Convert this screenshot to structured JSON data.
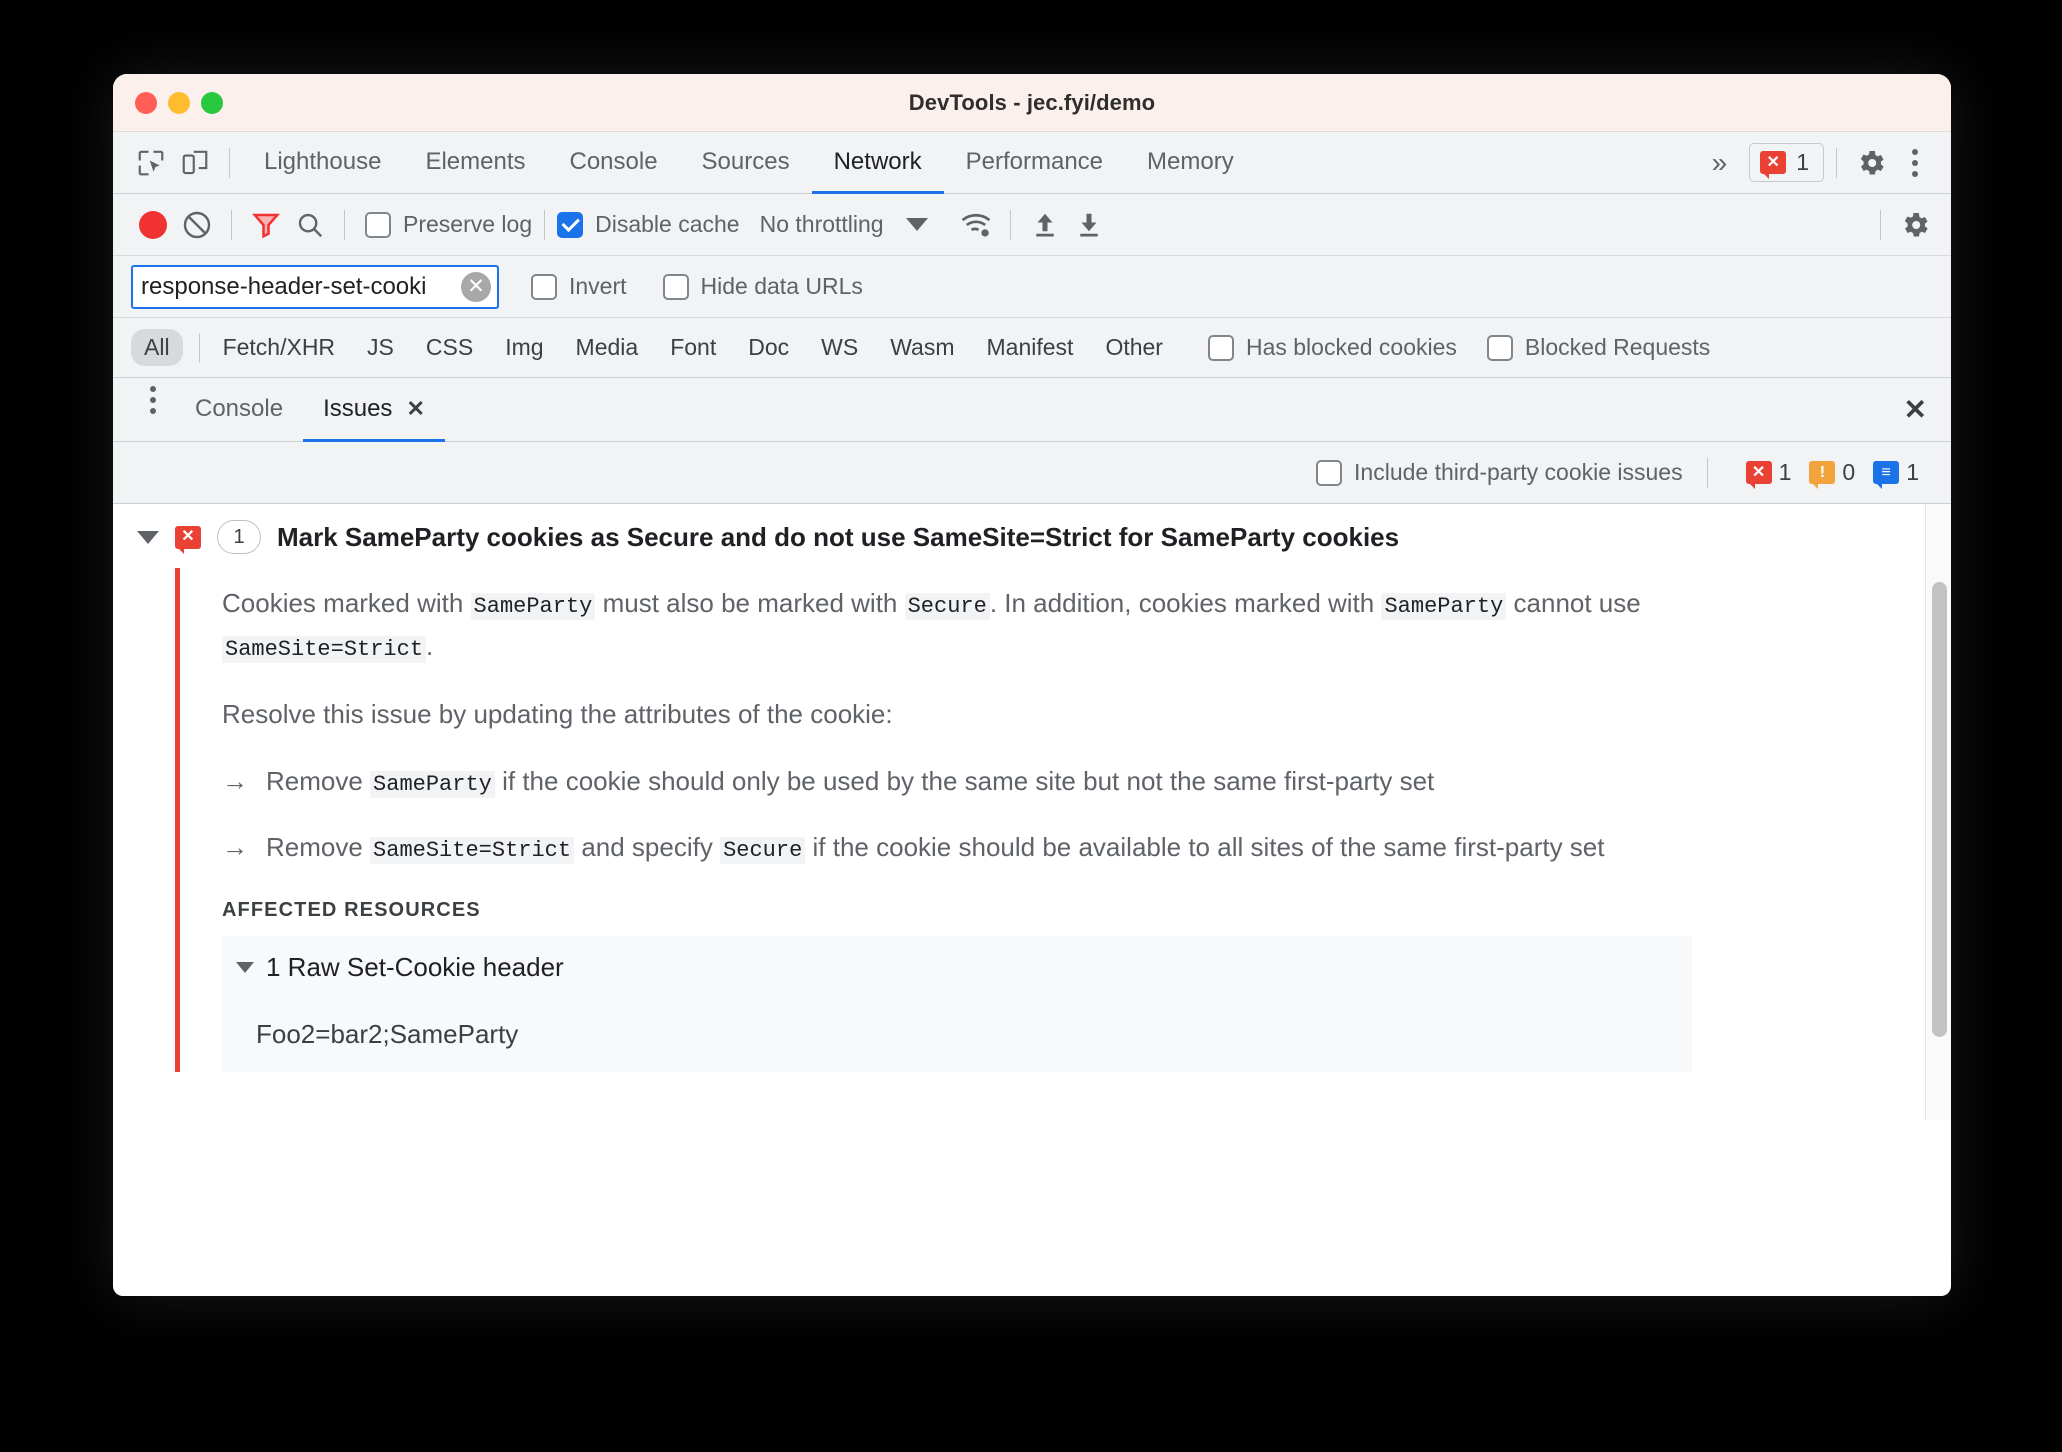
{
  "window": {
    "title": "DevTools - jec.fyi/demo",
    "traffic_lights": [
      "close-red",
      "minimize-yellow",
      "zoom-green"
    ]
  },
  "tabbar": {
    "left_icons": [
      "inspect-element-icon",
      "device-toolbar-icon"
    ],
    "tabs": [
      {
        "label": "Lighthouse",
        "active": false
      },
      {
        "label": "Elements",
        "active": false
      },
      {
        "label": "Console",
        "active": false
      },
      {
        "label": "Sources",
        "active": false
      },
      {
        "label": "Network",
        "active": true
      },
      {
        "label": "Performance",
        "active": false
      },
      {
        "label": "Memory",
        "active": false
      }
    ],
    "more_tabs": "»",
    "error_badge": {
      "icon": "error-bubble-icon",
      "glyph": "✕",
      "count": "1"
    },
    "settings_icon": "gear-icon",
    "menu_icon": "kebab-menu-icon"
  },
  "network_toolbar": {
    "record_button": "record-icon",
    "clear_button": "clear-icon",
    "filter_button": "filter-funnel-icon",
    "search_button": "search-icon",
    "preserve_log": {
      "label": "Preserve log",
      "checked": false
    },
    "disable_cache": {
      "label": "Disable cache",
      "checked": true
    },
    "throttling": "No throttling",
    "network_conditions_icon": "wifi-settings-icon",
    "import_har_icon": "import-arrow-icon",
    "export_har_icon": "export-arrow-icon",
    "settings_icon": "gear-icon"
  },
  "filter_row": {
    "input_value": "response-header-set-cooki",
    "input_placeholder": "Filter",
    "clear_glyph": "✕",
    "invert": {
      "label": "Invert",
      "checked": false
    },
    "hide_data_urls": {
      "label": "Hide data URLs",
      "checked": false
    }
  },
  "type_filters": {
    "items": [
      {
        "label": "All",
        "selected": true
      },
      {
        "label": "Fetch/XHR",
        "selected": false
      },
      {
        "label": "JS",
        "selected": false
      },
      {
        "label": "CSS",
        "selected": false
      },
      {
        "label": "Img",
        "selected": false
      },
      {
        "label": "Media",
        "selected": false
      },
      {
        "label": "Font",
        "selected": false
      },
      {
        "label": "Doc",
        "selected": false
      },
      {
        "label": "WS",
        "selected": false
      },
      {
        "label": "Wasm",
        "selected": false
      },
      {
        "label": "Manifest",
        "selected": false
      },
      {
        "label": "Other",
        "selected": false
      }
    ],
    "has_blocked_cookies": {
      "label": "Has blocked cookies",
      "checked": false
    },
    "blocked_requests": {
      "label": "Blocked Requests",
      "checked": false
    }
  },
  "drawer": {
    "menu_icon": "kebab-menu-icon",
    "tabs": [
      {
        "label": "Console",
        "active": false,
        "closable": false
      },
      {
        "label": "Issues",
        "active": true,
        "closable": true
      }
    ],
    "close_glyph": "✕",
    "close_drawer_glyph": "✕"
  },
  "issues_toolbar": {
    "include_third_party": {
      "label": "Include third-party cookie issues",
      "checked": false
    },
    "counters": [
      {
        "kind": "error",
        "glyph": "✕",
        "count": "1"
      },
      {
        "kind": "warning",
        "glyph": "!",
        "count": "0"
      },
      {
        "kind": "info",
        "glyph": "≡",
        "count": "1"
      }
    ]
  },
  "issue": {
    "expanded": true,
    "badge_glyph": "✕",
    "count": "1",
    "title": "Mark SameParty cookies as Secure and do not use SameSite=Strict for SameParty cookies",
    "paragraph1": {
      "p1": "Cookies marked with ",
      "c1": "SameParty",
      "p2": " must also be marked with ",
      "c2": "Secure",
      "p3": ". In addition, cookies marked with ",
      "c3": "SameParty",
      "p4": " cannot use ",
      "c4": "SameSite=Strict",
      "p5": "."
    },
    "paragraph2": "Resolve this issue by updating the attributes of the cookie:",
    "arrow_marker": "→",
    "list": [
      {
        "p1": "Remove ",
        "c1": "SameParty",
        "p2": " if the cookie should only be used by the same site but not the same first-party set",
        "c2": "",
        "p3": ""
      },
      {
        "p1": "Remove ",
        "c1": "SameSite=Strict",
        "p2": " and specify ",
        "c2": "Secure",
        "p3": " if the cookie should be available to all sites of the same first-party set"
      }
    ],
    "affected_resources_header": "AFFECTED RESOURCES",
    "resource_header": "1 Raw Set-Cookie header",
    "resource_value": "Foo2=bar2;SameParty"
  },
  "colors": {
    "accent": "#1a73e8",
    "error": "#e94235",
    "warning": "#f2a33c",
    "titlebar": "#fbf0ec",
    "toolbar": "#f1f3f4"
  }
}
